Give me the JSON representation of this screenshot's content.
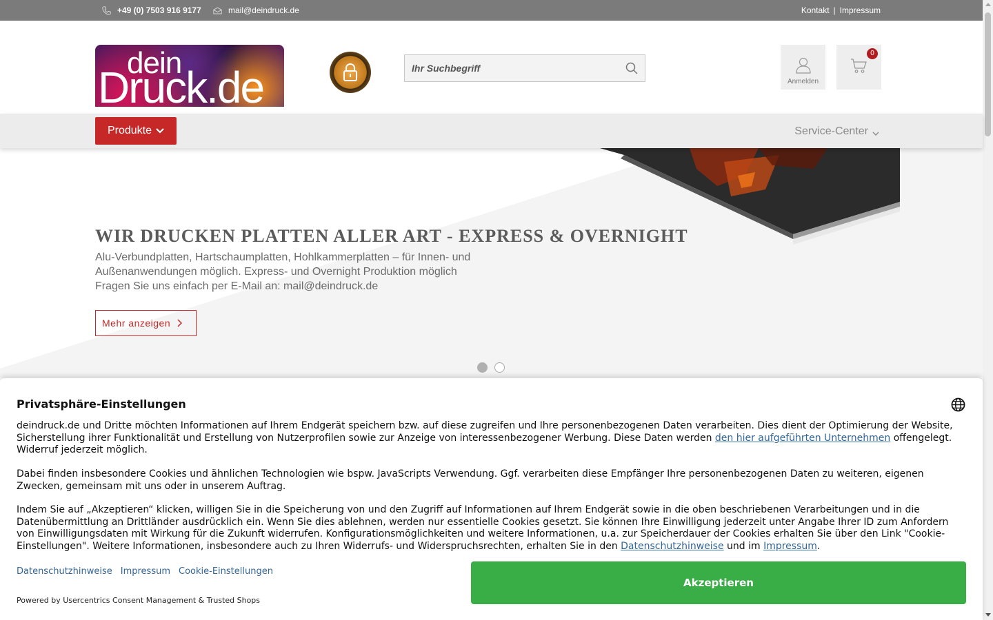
{
  "topbar": {
    "phone": "+49 (0) 7503 916 9177",
    "email": "mail@deindruck.de",
    "links": [
      "Kontakt",
      "Impressum"
    ],
    "background_color": "#7b7b7b"
  },
  "header": {
    "logo_line1": "dein",
    "logo_line2": "Druck.de",
    "search_placeholder": "Ihr Suchbegriff",
    "account_label": "Anmelden",
    "cart_count": "0",
    "seal_icon": "lock-seal-icon"
  },
  "nav": {
    "products_label": "Produkte",
    "service_label": "Service-Center",
    "accent_color": "#c62828"
  },
  "hero": {
    "title": "WIR DRUCKEN PLATTEN ALLER ART - EXPRESS & OVERNIGHT",
    "description_line1": "Alu-Verbundplatten, Hartschaumplatten, Hohlkammerplatten – für Innen- und",
    "description_line2": "Außenanwendungen möglich. Express- und Overnight Produktion möglich",
    "description_line3": "Fragen Sie uns einfach per E-Mail an: mail@deindruck.de",
    "more_label": "Mehr anzeigen",
    "slides": 2,
    "active_slide": 1
  },
  "cookie": {
    "title": "Privatsphäre-Einstellungen",
    "p1_a": "deindruck.de und Dritte möchten Informationen auf Ihrem Endgerät speichern bzw. auf diese zugreifen und Ihre personenbezogenen Daten verarbeiten. Dies dient der Optimierung der Website, Sicherstellung ihrer Funktionalität und Erstellung von Nutzerprofilen sowie zur Anzeige von interessenbezogener Werbung. Diese Daten werden ",
    "p1_link": "den hier aufgeführten Unternehmen",
    "p1_b": " offengelegt. Widerruf jederzeit möglich.",
    "p2": "Dabei finden insbesondere Cookies und ähnlichen Technologien wie bspw. JavaScripts Verwendung. Ggf. verarbeiten diese Empfänger Ihre personenbezogenen Daten zu weiteren, eigenen Zwecken, gemeinsam mit uns oder in unserem Auftrag.",
    "p3_a": "Indem Sie auf „Akzeptieren“ klicken, willigen Sie in die Speicherung von und den Zugriff auf Informationen auf Ihrem Endgerät sowie in die oben beschriebenen Verarbeitungen und in die Datenübermittlung an Drittländer ausdrücklich ein. Wenn Sie dies ablehnen, werden nur essentielle Cookies gesetzt. Sie können Ihre Einwilligung jederzeit unter Angabe Ihrer ID zum Anfordern von Einwilligungsdaten mit Wirkung für die Zukunft widerrufen. Konfigurationsmöglichkeiten und weitere Informationen, u.a. zur Speicherdauer der Cookies erhalten Sie über den Link \"Cookie-Einstellungen\". Weitere Informationen, insbesondere auch zu Ihren Widerrufs- und Widerspruchsrechten, erhalten Sie in den ",
    "p3_link1": "Datenschutzhinweise",
    "p3_mid": " und im ",
    "p3_link2": "Impressum",
    "p3_end": ".",
    "footer_links": [
      "Datenschutzhinweise",
      "Impressum",
      "Cookie-Einstellungen"
    ],
    "accept_label": "Akzeptieren",
    "powered_by": "Powered by Usercentrics Consent Management & Trusted Shops",
    "accept_color": "#3aae46",
    "link_color": "#336699"
  }
}
